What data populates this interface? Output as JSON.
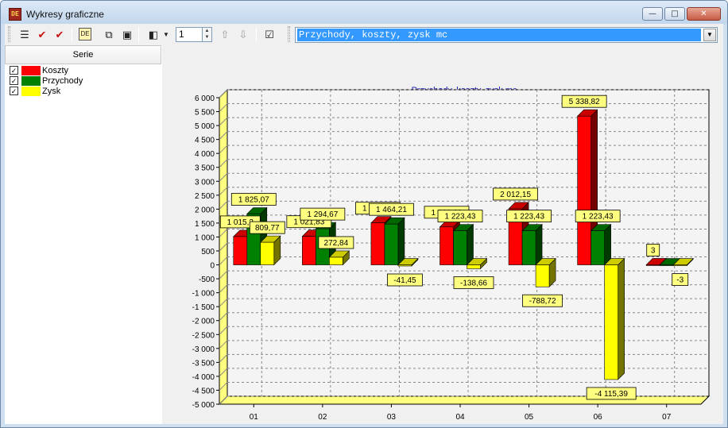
{
  "window": {
    "title": "Wykresy graficzne",
    "app_icon_text": "DE",
    "minimize_label": "—",
    "maximize_label": "□",
    "close_label": "✕"
  },
  "toolbar": {
    "list_icon": "list-icon",
    "check_all_icon": "check-all-icon",
    "uncheck_icon": "check-icon",
    "de_icon": "de-icon",
    "copy_icon": "copy-icon",
    "save_icon": "save-icon",
    "chart_type_icon": "chart-type-icon",
    "spin_value": "1",
    "up_icon": "arrow-up-icon",
    "down_icon": "arrow-down-icon",
    "select_icon": "checklist-icon",
    "chart_selector_value": "Przychody, koszty, zysk mc"
  },
  "series_panel": {
    "header": "Serie",
    "items": [
      {
        "label": "Koszty",
        "color": "#ff0000",
        "checked": true
      },
      {
        "label": "Przychody",
        "color": "#008000",
        "checked": true
      },
      {
        "label": "Zysk",
        "color": "#ffff00",
        "checked": true
      }
    ]
  },
  "chart_data": {
    "type": "bar",
    "title": "Przychody, koszty, zysk mc",
    "categories": [
      "01",
      "02",
      "03",
      "04",
      "05",
      "06",
      "07"
    ],
    "series": [
      {
        "name": "Koszty",
        "color": "#ff0000",
        "values": [
          1015.3,
          1021.83,
          1505.66,
          1361.09,
          2012.15,
          5338.82,
          3
        ]
      },
      {
        "name": "Przychody",
        "color": "#008000",
        "values": [
          1825.07,
          1294.67,
          1464.21,
          1223.43,
          1223.43,
          1223.43,
          0
        ]
      },
      {
        "name": "Zysk",
        "color": "#ffff00",
        "values": [
          809.77,
          272.84,
          -41.45,
          -138.66,
          -788.72,
          -4115.39,
          -3
        ]
      }
    ],
    "data_labels": [
      [
        "1 015,3",
        "1 825,07",
        "809,77"
      ],
      [
        "1 021,83",
        "1 294,67",
        "272,84"
      ],
      [
        "1 505,66",
        "1 464,21",
        "-41,45"
      ],
      [
        "1 361,09",
        "1 223,43",
        "-138,66"
      ],
      [
        "2 012,15",
        "1 223,43",
        "-788,72"
      ],
      [
        "5 338,82",
        "1 223,43",
        "-4 115,39"
      ],
      [
        "3",
        "",
        "-3"
      ]
    ],
    "y_ticks": [
      6000,
      5500,
      5000,
      4500,
      4000,
      3500,
      3000,
      2500,
      2000,
      1500,
      1000,
      500,
      0,
      -500,
      -1000,
      -1500,
      -2000,
      -2500,
      -3000,
      -3500,
      -4000,
      -4500,
      -5000
    ],
    "y_tick_labels": [
      "6 000",
      "5 500",
      "5 000",
      "4 500",
      "4 000",
      "3 500",
      "3 000",
      "2 500",
      "2 000",
      "1 500",
      "1 000",
      "500",
      "0",
      "-500",
      "-1 000",
      "-1 500",
      "-2 000",
      "-2 500",
      "-3 000",
      "-3 500",
      "-4 000",
      "-4 500",
      "-5 000"
    ],
    "ylim": [
      -5000,
      6000
    ],
    "grid": true,
    "legend": "none"
  }
}
